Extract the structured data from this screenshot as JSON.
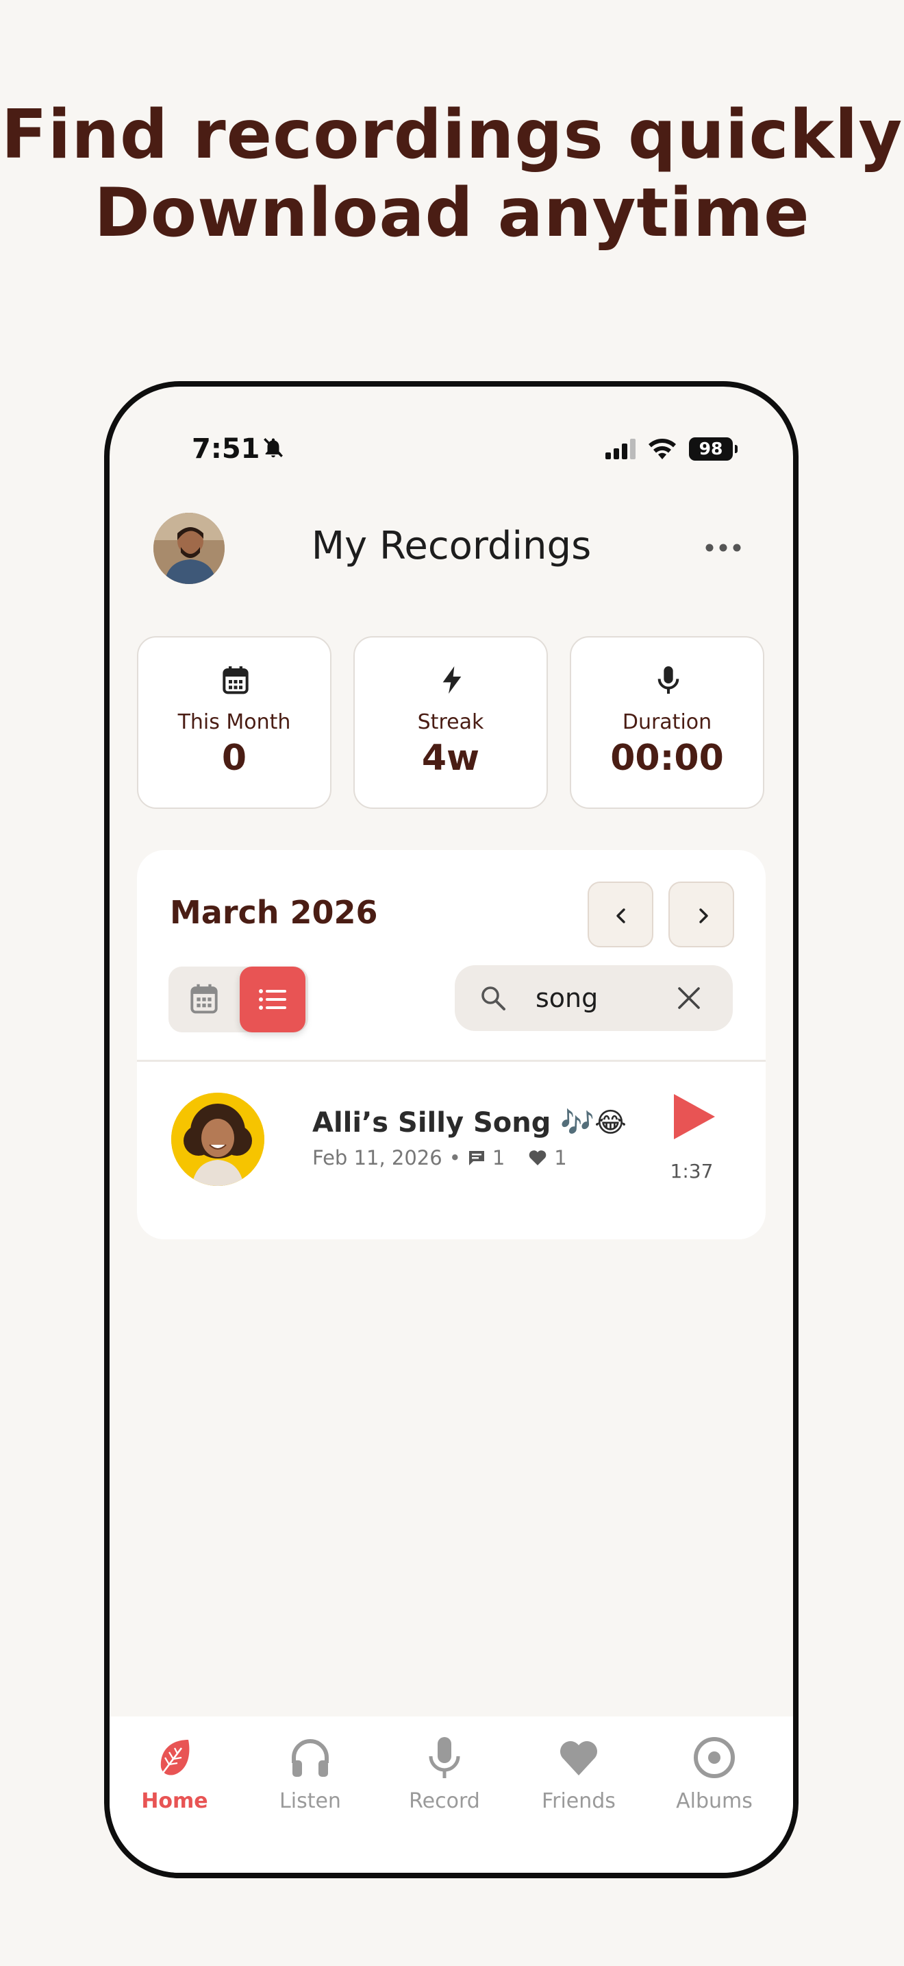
{
  "headline": {
    "line1": "Find recordings quickly",
    "line2": "Download anytime"
  },
  "status_bar": {
    "time": "7:51",
    "battery": "98"
  },
  "header": {
    "title": "My Recordings"
  },
  "stats": [
    {
      "icon": "calendar-icon",
      "label": "This Month",
      "value": "0"
    },
    {
      "icon": "lightning-icon",
      "label": "Streak",
      "value": "4w"
    },
    {
      "icon": "microphone-icon",
      "label": "Duration",
      "value": "00:00"
    }
  ],
  "calendar": {
    "month": "March 2026",
    "active_view": "list"
  },
  "search": {
    "value": "song"
  },
  "recordings": [
    {
      "title": "Alli’s Silly Song 🎶😂",
      "date": "Feb 11, 2026",
      "comments": "1",
      "likes": "1",
      "duration": "1:37"
    }
  ],
  "tabs": [
    {
      "icon": "leaf-icon",
      "label": "Home",
      "active": true
    },
    {
      "icon": "headphones-icon",
      "label": "Listen",
      "active": false
    },
    {
      "icon": "microphone-icon",
      "label": "Record",
      "active": false
    },
    {
      "icon": "heart-icon",
      "label": "Friends",
      "active": false
    },
    {
      "icon": "album-icon",
      "label": "Albums",
      "active": false
    }
  ],
  "colors": {
    "accent": "#e85454",
    "brown": "#4a1d14",
    "background": "#f8f6f3"
  }
}
